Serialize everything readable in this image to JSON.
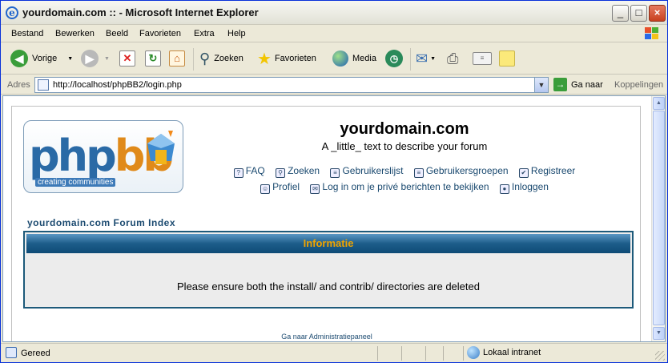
{
  "window": {
    "title": "yourdomain.com :: - Microsoft Internet Explorer",
    "minimize": "_",
    "maximize": "□",
    "close": "×"
  },
  "menu": {
    "items": [
      "Bestand",
      "Bewerken",
      "Beeld",
      "Favorieten",
      "Extra",
      "Help"
    ]
  },
  "toolbar": {
    "back_label": "Vorige",
    "search_label": "Zoeken",
    "favorites_label": "Favorieten",
    "media_label": "Media"
  },
  "address": {
    "label": "Adres",
    "url": "http://localhost/phpBB2/login.php",
    "go_label": "Ga naar",
    "links_label": "Koppelingen"
  },
  "forum": {
    "logo_word_a": "php",
    "logo_word_b": "bb",
    "logo_tagline": "creating communities",
    "site_title": "yourdomain.com",
    "site_description": "A _little_ text to describe your forum",
    "nav_row1": [
      "FAQ",
      "Zoeken",
      "Gebruikerslijst",
      "Gebruikersgroepen",
      "Registreer"
    ],
    "nav_row2": [
      "Profiel",
      "Log in om je privé berichten te bekijken",
      "Inloggen"
    ],
    "index_link": "yourdomain.com Forum Index",
    "info_header": "Informatie",
    "info_message": "Please ensure both the install/ and contrib/ directories are deleted",
    "admin_link": "Ga naar Administratiepaneel"
  },
  "status": {
    "text": "Gereed",
    "zone": "Lokaal intranet"
  },
  "colors": {
    "header_gold": "#f0a400",
    "forum_blue": "#1b4a70",
    "xp_blue": "#0831D9"
  }
}
